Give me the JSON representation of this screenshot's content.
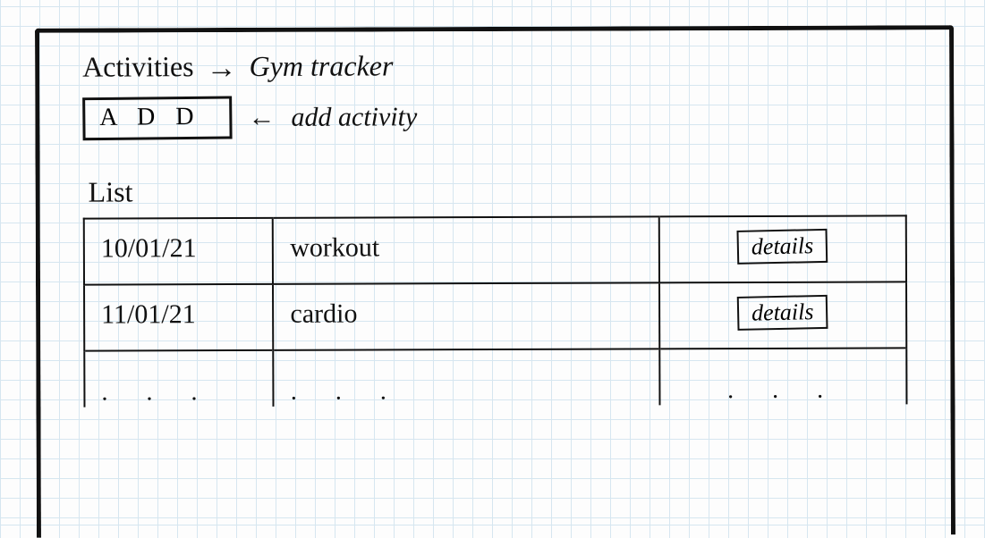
{
  "header": {
    "title": "Activities",
    "arrow_glyph": "→",
    "subtitle": "Gym tracker"
  },
  "add": {
    "button_label": "A D D",
    "arrow_glyph": "←",
    "annotation": "add activity"
  },
  "list": {
    "heading": "List",
    "details_label": "details",
    "rows": [
      {
        "date": "10/01/21",
        "name": "workout"
      },
      {
        "date": "11/01/21",
        "name": "cardio"
      }
    ],
    "ellipsis": ". . ."
  }
}
